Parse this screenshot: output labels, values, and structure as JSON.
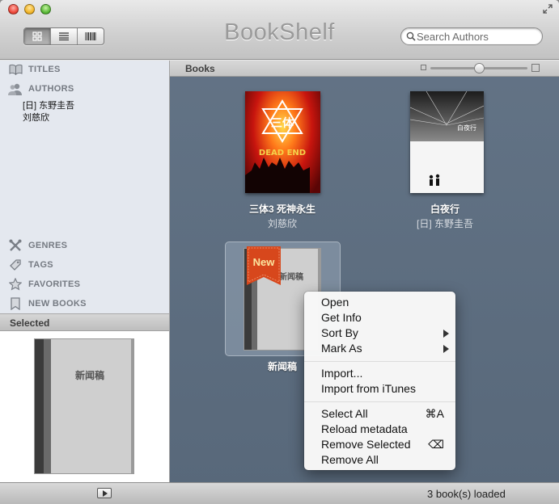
{
  "app": {
    "title": "BookShelf"
  },
  "search": {
    "placeholder": "Search Authors"
  },
  "view_modes": [
    "grid",
    "list",
    "cover-flow"
  ],
  "sidebar": {
    "items": [
      {
        "label": "TITLES",
        "icon": "book-open-icon"
      },
      {
        "label": "AUTHORS",
        "icon": "people-icon"
      },
      {
        "label": "GENRES",
        "icon": "tools-icon"
      },
      {
        "label": "TAGS",
        "icon": "tag-icon"
      },
      {
        "label": "FAVORITES",
        "icon": "star-icon"
      },
      {
        "label": "NEW BOOKS",
        "icon": "bookmark-icon"
      }
    ],
    "authors": [
      "[日] 东野圭吾",
      "刘慈欣"
    ],
    "selected_header": "Selected",
    "selected_book_title": "新闻稿"
  },
  "main": {
    "header_label": "Books",
    "zoom_level": 0.5,
    "books": [
      {
        "title": "三体3 死神永生",
        "author": "刘慈欣",
        "cover_text": "三体",
        "cover_sub": "DEAD END"
      },
      {
        "title": "白夜行",
        "author": "[日] 东野圭吾",
        "cover_text": "白夜行"
      },
      {
        "title": "新闻稿",
        "author": "",
        "cover_text": "新闻稿",
        "badge": "New"
      }
    ]
  },
  "context_menu": {
    "group1": [
      {
        "label": "Open"
      },
      {
        "label": "Get Info"
      },
      {
        "label": "Sort By",
        "submenu": true
      },
      {
        "label": "Mark As",
        "submenu": true
      }
    ],
    "group2": [
      {
        "label": "Import..."
      },
      {
        "label": "Import from iTunes"
      }
    ],
    "group3": [
      {
        "label": "Select All",
        "shortcut": "⌘A"
      },
      {
        "label": "Reload metadata"
      },
      {
        "label": "Remove Selected",
        "shortcut": "⌫"
      },
      {
        "label": "Remove All"
      }
    ]
  },
  "status": {
    "text": "3 book(s) loaded"
  }
}
